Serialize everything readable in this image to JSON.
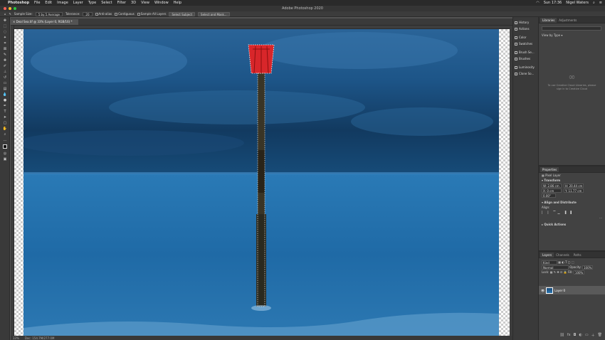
{
  "menubar": {
    "apple": "",
    "app": "Photoshop",
    "items": [
      "File",
      "Edit",
      "Image",
      "Layer",
      "Type",
      "Select",
      "Filter",
      "3D",
      "View",
      "Window",
      "Help"
    ],
    "clock": "Sun 17:36",
    "user": "Nigel Waters"
  },
  "window_title": "Adobe Photoshop 2020",
  "options": {
    "sample_size_label": "Sample Size:",
    "sample_size_value": "5 by 5 Average",
    "tolerance_label": "Tolerance:",
    "tolerance_value": "20",
    "anti_alias": "Anti-alias",
    "contiguous": "Contiguous",
    "sample_all": "Sample All Layers",
    "select_subject": "Select Subject",
    "select_mask": "Select and Mask..."
  },
  "document_tab": "Deal Sea.tif @ 33% (Layer 0, RGB/16) *",
  "status": {
    "zoom": "33%",
    "doc": "Doc: 154.7M/277.0M"
  },
  "collapsed_panels": [
    "History",
    "Actions",
    "Color",
    "Swatches",
    "Brush Se...",
    "Brushes",
    "Luminosity",
    "Clone So..."
  ],
  "libraries": {
    "tabs": [
      "Libraries",
      "Adjustments"
    ],
    "view_by": "View by Type",
    "message": "To use Creative Cloud Libraries, please sign in to Creative Cloud"
  },
  "properties": {
    "title": "Properties",
    "kind": "Pixel Layer",
    "transform": "Transform",
    "w": "W: 2.86 cm",
    "h": "H: 20.44 cm",
    "x": "X: 0 cm",
    "y": "Y: 11.77 cm",
    "angle": "0.00°",
    "align": "Align and Distribute",
    "align_label": "Align:",
    "quick": "Quick Actions"
  },
  "layers": {
    "tabs": [
      "Layers",
      "Channels",
      "Paths"
    ],
    "filter": "Kind",
    "blend": "Normal",
    "opacity_label": "Opacity:",
    "opacity": "100%",
    "lock": "Lock:",
    "fill_label": "Fill:",
    "fill": "100%",
    "layer_name": "Layer 0"
  }
}
